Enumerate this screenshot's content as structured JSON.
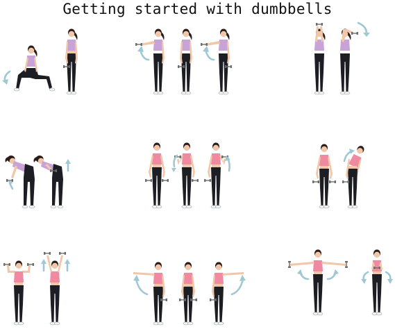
{
  "title": "Getting started with dumbbells",
  "colors": {
    "background": "#ffffff",
    "top_purple": "#c7a3d8",
    "top_pink": "#f08aa0",
    "leggings": "#1d1d24",
    "skin": "#f2c6a8",
    "hair": "#2b1d1a",
    "arrow": "#9fc8d4",
    "dumbbell": "#6b6b6b"
  },
  "figure": {
    "description_icons": [
      "lunge",
      "front-raise",
      "overhead-extension",
      "bent-over-row",
      "bicep-curl",
      "side-bend",
      "shoulder-press",
      "lateral-raise",
      "side-arm-raise"
    ]
  }
}
